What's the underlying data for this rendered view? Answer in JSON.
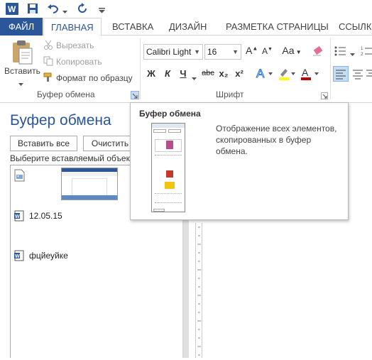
{
  "colors": {
    "accent": "#2b579a",
    "word_blue": "#2b579a",
    "highlight_yellow": "#ffff00",
    "font_red": "#c00000"
  },
  "tabs": {
    "file": "ФАЙЛ",
    "home": "ГЛАВНАЯ",
    "insert": "ВСТАВКА",
    "design": "ДИЗАЙН",
    "layout": "РАЗМЕТКА СТРАНИЦЫ",
    "refs": "ССЫЛКИ"
  },
  "clipboard_group": {
    "paste": "Вставить",
    "cut": "Вырезать",
    "copy": "Копировать",
    "format_painter": "Формат по образцу",
    "label": "Буфер обмена"
  },
  "font_group": {
    "font_name": "Calibri Light",
    "font_size": "16",
    "label": "Шрифт",
    "bold": "Ж",
    "italic": "К",
    "underline": "Ч",
    "strike": "abc",
    "subscript": "x₂",
    "superscript": "x²",
    "change_case": "Aa",
    "grow": "A",
    "shrink": "A"
  },
  "pane": {
    "title": "Буфер обмена",
    "paste_all": "Вставить все",
    "clear_all": "Очистить",
    "prompt": "Выберите вставляемый объект:",
    "items": [
      {
        "type": "image",
        "text": ""
      },
      {
        "type": "word",
        "text": "12.05.15"
      },
      {
        "type": "word",
        "text": "фцйеуйке"
      }
    ]
  },
  "tooltip": {
    "title": "Буфер обмена",
    "description": "Отображение всех элементов, скопированных в буфер обмена."
  }
}
